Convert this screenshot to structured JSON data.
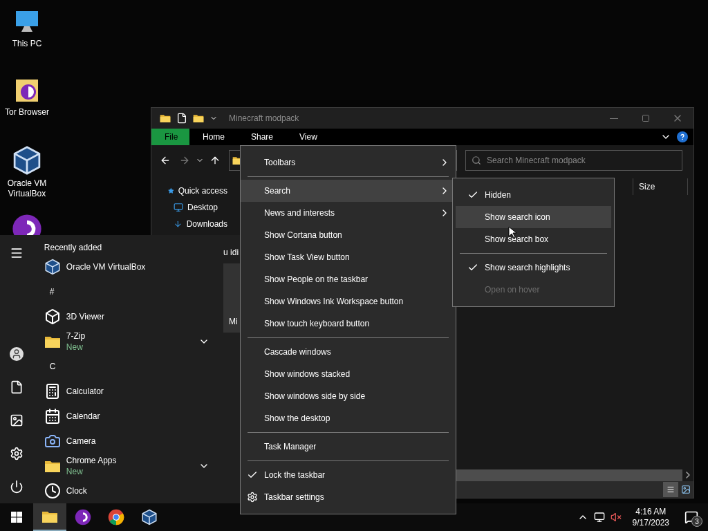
{
  "desktop_icons": [
    {
      "label": "This PC"
    },
    {
      "label": "Tor Browser"
    },
    {
      "label": "Oracle VM VirtualBox"
    }
  ],
  "explorer": {
    "title": "Minecraft modpack",
    "ribbon_tabs": [
      {
        "label": "File",
        "selected": true
      },
      {
        "label": "Home",
        "selected": false
      },
      {
        "label": "Share",
        "selected": false
      },
      {
        "label": "View",
        "selected": false
      }
    ],
    "search": {
      "placeholder": "Search Minecraft modpack"
    },
    "nav": [
      {
        "label": "Quick access"
      },
      {
        "label": "Desktop"
      },
      {
        "label": "Downloads"
      }
    ],
    "columns": [
      "Size"
    ]
  },
  "start_menu": {
    "header": "Recently added",
    "items": [
      {
        "kind": "app",
        "label": "Oracle VM VirtualBox"
      },
      {
        "kind": "letter",
        "label": "#"
      },
      {
        "kind": "app",
        "label": "3D Viewer"
      },
      {
        "kind": "folder",
        "label": "7-Zip",
        "badge": "New",
        "expanded": false
      },
      {
        "kind": "letter",
        "label": "C"
      },
      {
        "kind": "app",
        "label": "Calculator"
      },
      {
        "kind": "app",
        "label": "Calendar"
      },
      {
        "kind": "app",
        "label": "Camera"
      },
      {
        "kind": "folder",
        "label": "Chrome Apps",
        "badge": "New",
        "expanded": false
      },
      {
        "kind": "app",
        "label": "Clock"
      }
    ],
    "tiles_header": "u idi",
    "tile_label": "Mi"
  },
  "context_menu": {
    "items": [
      {
        "kind": "submenu",
        "label": "Toolbars",
        "selected": false
      },
      {
        "kind": "separator"
      },
      {
        "kind": "submenu",
        "label": "Search",
        "selected": true
      },
      {
        "kind": "submenu",
        "label": "News and interests",
        "selected": false
      },
      {
        "kind": "item",
        "label": "Show Cortana button",
        "selected": false
      },
      {
        "kind": "item",
        "label": "Show Task View button",
        "selected": false
      },
      {
        "kind": "item",
        "label": "Show People on the taskbar",
        "selected": false
      },
      {
        "kind": "item",
        "label": "Show Windows Ink Workspace button",
        "selected": false
      },
      {
        "kind": "item",
        "label": "Show touch keyboard button",
        "selected": false
      },
      {
        "kind": "separator"
      },
      {
        "kind": "item",
        "label": "Cascade windows",
        "selected": false
      },
      {
        "kind": "item",
        "label": "Show windows stacked",
        "selected": false
      },
      {
        "kind": "item",
        "label": "Show windows side by side",
        "selected": false
      },
      {
        "kind": "item",
        "label": "Show the desktop",
        "selected": false
      },
      {
        "kind": "separator"
      },
      {
        "kind": "item",
        "label": "Task Manager",
        "selected": false
      },
      {
        "kind": "separator"
      },
      {
        "kind": "check",
        "label": "Lock the taskbar",
        "checked": true,
        "selected": false
      },
      {
        "kind": "settings",
        "label": "Taskbar settings",
        "selected": false
      }
    ]
  },
  "search_submenu": {
    "items": [
      {
        "kind": "check",
        "label": "Hidden",
        "checked": true,
        "selected": false,
        "disabled": false
      },
      {
        "kind": "check",
        "label": "Show search icon",
        "checked": false,
        "selected": true,
        "disabled": false
      },
      {
        "kind": "check",
        "label": "Show search box",
        "checked": false,
        "selected": false,
        "disabled": false
      },
      {
        "kind": "separator"
      },
      {
        "kind": "check",
        "label": "Show search highlights",
        "checked": true,
        "selected": false,
        "disabled": false
      },
      {
        "kind": "check",
        "label": "Open on hover",
        "checked": false,
        "selected": false,
        "disabled": true
      }
    ]
  },
  "taskbar": {
    "pinned": [
      {
        "selected": true
      },
      {
        "selected": false
      },
      {
        "selected": false
      },
      {
        "selected": false
      }
    ],
    "time": "4:16 AM",
    "date": "9/17/2023",
    "notifications": "3"
  }
}
